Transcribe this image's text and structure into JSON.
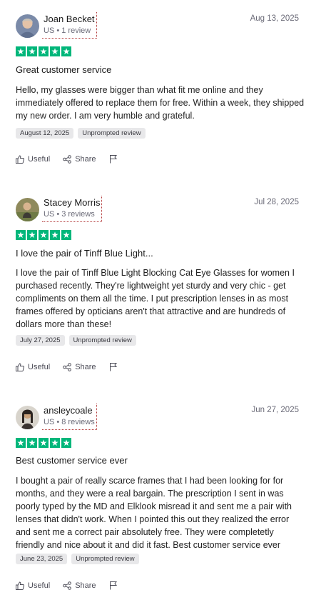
{
  "reviews": [
    {
      "author": "Joan Becket",
      "meta": "US • 1 review",
      "date": "Aug 13, 2025",
      "rating": 5,
      "title": "Great customer service",
      "body": "Hello, my glasses were bigger than what fit me online and they immediately offered to replace them for free. Within a week, they shipped my new order. I am very humble and grateful.",
      "tags": [
        "August 12, 2025",
        "Unprompted review"
      ],
      "actions": {
        "useful": "Useful",
        "share": "Share"
      }
    },
    {
      "author": "Stacey Morris",
      "meta": "US • 3 reviews",
      "date": "Jul 28, 2025",
      "rating": 5,
      "title": "I love the pair of Tinff Blue Light...",
      "body": "I love the pair of Tinff Blue Light Blocking Cat Eye Glasses for women I purchased recently. They're lightweight yet sturdy and very chic - get compliments on them all the time. I put prescription lenses in as most frames offered by opticians aren't that attractive and are hundreds of dollars more than these!",
      "tags": [
        "July 27, 2025",
        "Unprompted review"
      ],
      "actions": {
        "useful": "Useful",
        "share": "Share"
      }
    },
    {
      "author": "ansleycoale",
      "meta": "US • 8 reviews",
      "date": "Jun 27, 2025",
      "rating": 5,
      "title": "Best customer service ever",
      "body": "I bought a pair of really scarce frames that I had been looking for for months, and they were a real bargain. The prescription I sent in was poorly typed by the MD and Elklook misread it and sent me a pair with lenses that didn't work. When I pointed this out they realized the error and sent me a correct pair absolutely free. They were completetly friendly and nice about it and did it fast. Best customer service ever",
      "tags": [
        "June 23, 2025",
        "Unprompted review"
      ],
      "actions": {
        "useful": "Useful",
        "share": "Share"
      }
    }
  ],
  "colors": {
    "star_green": "#00b67a",
    "tag_bg": "#e8e8ea",
    "meta_gray": "#6b6b78"
  },
  "icons": [
    "thumbs-up-icon",
    "share-icon",
    "flag-icon",
    "star-icon"
  ]
}
